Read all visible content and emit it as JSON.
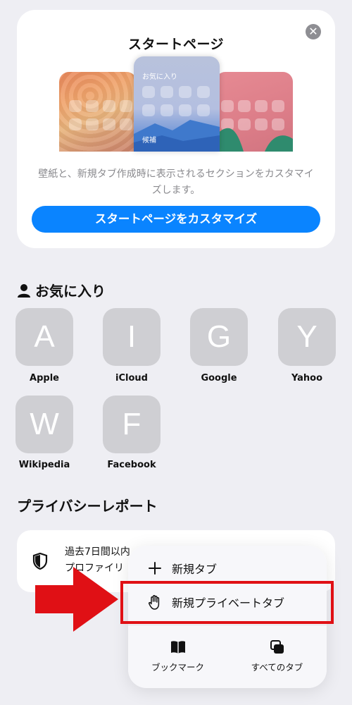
{
  "start_page": {
    "title": "スタートページ",
    "preview_favorites_label": "お気に入り",
    "preview_suggestions_label": "候補",
    "description": "壁紙と、新規タブ作成時に表示されるセクションをカスタマイズします。",
    "customize_button": "スタートページをカスタマイズ"
  },
  "favorites": {
    "header": "お気に入り",
    "items": [
      {
        "letter": "A",
        "name": "Apple"
      },
      {
        "letter": "I",
        "name": "iCloud"
      },
      {
        "letter": "G",
        "name": "Google"
      },
      {
        "letter": "Y",
        "name": "Yahoo"
      },
      {
        "letter": "W",
        "name": "Wikipedia"
      },
      {
        "letter": "F",
        "name": "Facebook"
      }
    ]
  },
  "privacy": {
    "title": "プライバシーレポート",
    "text_line1": "過去7日間以内",
    "text_line2": "プロファイリ"
  },
  "context_menu": {
    "new_tab": "新規タブ",
    "new_private_tab": "新規プライベートタブ",
    "bookmarks": "ブックマーク",
    "all_tabs": "すべてのタブ"
  },
  "colors": {
    "accent": "#0a84ff",
    "highlight": "#e01015",
    "background": "#eeeef3"
  }
}
